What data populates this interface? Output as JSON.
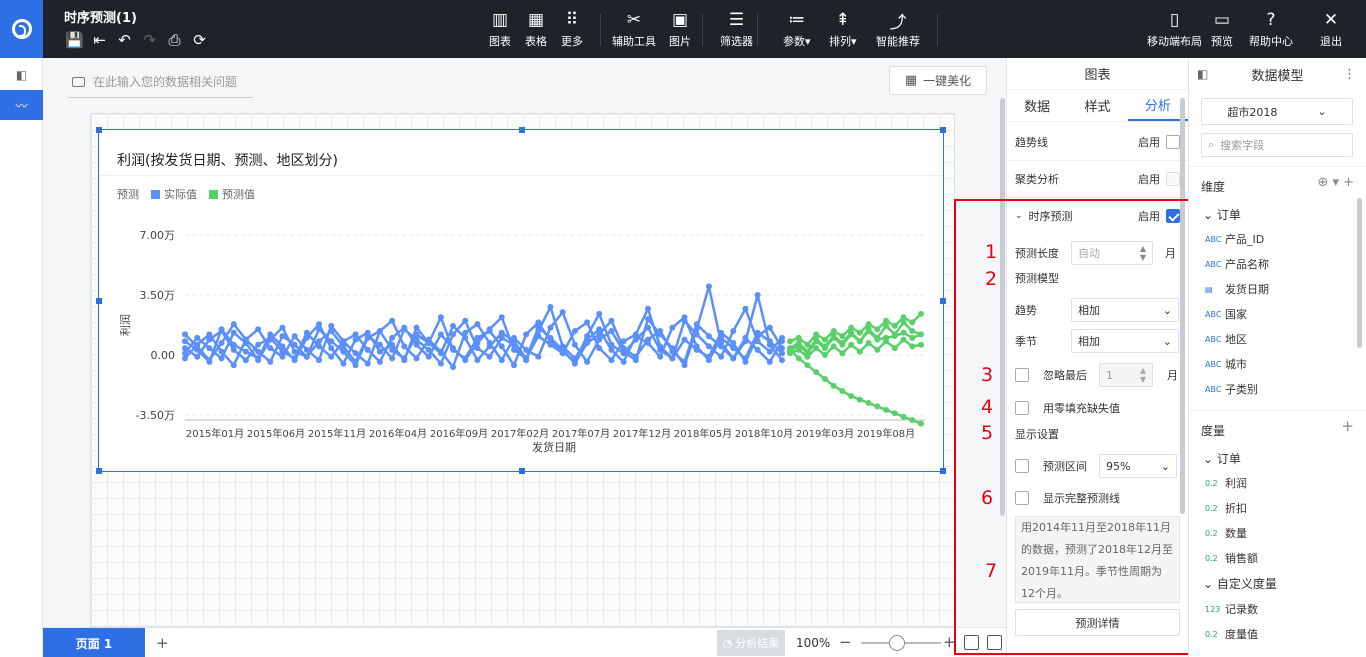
{
  "app": {
    "title": "时序预测(1)",
    "toolbar": [
      {
        "name": "chart",
        "label": "图表",
        "icon": "▥"
      },
      {
        "name": "table",
        "label": "表格",
        "icon": "▦"
      },
      {
        "name": "more",
        "label": "更多",
        "icon": "⠿"
      },
      {
        "name": "assist",
        "label": "辅助工具",
        "icon": "✂"
      },
      {
        "name": "image",
        "label": "图片",
        "icon": "▣"
      },
      {
        "name": "filter",
        "label": "筛选器",
        "icon": "☰"
      },
      {
        "name": "param",
        "label": "参数▾",
        "icon": "≔"
      },
      {
        "name": "layout",
        "label": "排列▾",
        "icon": "⇞"
      },
      {
        "name": "recommend",
        "label": "智能推荐",
        "icon": "⤴"
      }
    ],
    "right_actions": [
      {
        "name": "mobile",
        "label": "移动端布局",
        "icon": "▯"
      },
      {
        "name": "preview",
        "label": "预览",
        "icon": "▭"
      },
      {
        "name": "help",
        "label": "帮助中心",
        "icon": "?"
      },
      {
        "name": "exit",
        "label": "退出",
        "icon": "✕"
      }
    ]
  },
  "canvas": {
    "question_placeholder": "在此输入您的数据相关问题",
    "beautify_label": "一键美化"
  },
  "chart": {
    "title": "利润(按发货日期、预测、地区划分)",
    "legend_title": "预测",
    "legend_actual": "实际值",
    "legend_forecast": "预测值",
    "color_actual": "#5b8ff9",
    "color_forecast": "#5ad06b",
    "ylabel": "利润",
    "xlabel": "发货日期"
  },
  "chart_data": {
    "type": "line",
    "title": "利润(按发货日期、预测、地区划分)",
    "xlabel": "发货日期",
    "ylabel": "利润",
    "ylim": [
      -35000,
      70000
    ],
    "yticks": [
      "7.00万",
      "3.50万",
      "0.00",
      "-3.50万"
    ],
    "ytick_values": [
      70000,
      35000,
      0,
      -35000
    ],
    "xticks": [
      "2015年01月",
      "2015年06月",
      "2015年11月",
      "2016年04月",
      "2016年09月",
      "2017年02月",
      "2017年07月",
      "2017年12月",
      "2018年05月",
      "2018年10月",
      "2019年03月",
      "2019年08月"
    ],
    "legend": [
      "实际值",
      "预测值"
    ],
    "actual_series": [
      {
        "name": "实际值",
        "values": [
          8000,
          3000,
          -4000,
          15000,
          6000,
          2000,
          -2000,
          12000,
          5000,
          -3000,
          10000,
          18000,
          4000,
          -5000,
          9000,
          13000,
          2000,
          6000,
          -3000,
          16000,
          7000,
          22000,
          3000,
          -2000,
          10000,
          14000,
          5000,
          -6000,
          12000,
          19000,
          8000,
          2000,
          -4000,
          11000,
          24000,
          6000,
          1000,
          9000,
          16000,
          3000,
          -2000,
          20000,
          12000,
          5000,
          -1000,
          14000,
          27000,
          8000,
          2000,
          10000
        ]
      },
      {
        "name": "实际值",
        "values": [
          -2000,
          6000,
          12000,
          2000,
          -6000,
          9000,
          15000,
          4000,
          -1000,
          11000,
          3000,
          -3000,
          17000,
          8000,
          1000,
          -5000,
          14000,
          20000,
          5000,
          -2000,
          9000,
          2000,
          -7000,
          13000,
          18000,
          7000,
          -3000,
          10000,
          3000,
          -1000,
          16000,
          25000,
          6000,
          -4000,
          9000,
          14000,
          2000,
          -3000,
          21000,
          12000,
          4000,
          -6000,
          15000,
          40000,
          7000,
          -2000,
          10000,
          3000,
          -4000,
          8000
        ]
      },
      {
        "name": "实际值",
        "values": [
          4000,
          -1000,
          9000,
          14000,
          3000,
          -3000,
          6000,
          10000,
          2000,
          -2000,
          13000,
          5000,
          -1000,
          8000,
          12000,
          3000,
          -4000,
          10000,
          16000,
          6000,
          -1000,
          12000,
          4000,
          -3000,
          7000,
          15000,
          22000,
          3000,
          -2000,
          11000,
          6000,
          1000,
          14000,
          19000,
          4000,
          -3000,
          8000,
          12000,
          27000,
          5000,
          -2000,
          9000,
          3000,
          -1000,
          13000,
          7000,
          -4000,
          11000,
          16000,
          4000
        ]
      },
      {
        "name": "实际值",
        "values": [
          12000,
          5000,
          -3000,
          7000,
          18000,
          9000,
          2000,
          -4000,
          11000,
          6000,
          -1000,
          15000,
          8000,
          2000,
          -6000,
          10000,
          14000,
          3000,
          -2000,
          12000,
          7000,
          1000,
          17000,
          10000,
          -3000,
          5000,
          13000,
          8000,
          -2000,
          16000,
          10000,
          3000,
          -5000,
          7000,
          12000,
          20000,
          4000,
          -1000,
          9000,
          14000,
          2000,
          -4000,
          18000,
          11000,
          5000,
          -2000,
          8000,
          35000,
          6000,
          -3000
        ]
      },
      {
        "name": "实际值",
        "values": [
          1000,
          10000,
          4000,
          -2000,
          13000,
          7000,
          -3000,
          9000,
          16000,
          2000,
          -1000,
          8000,
          14000,
          5000,
          -4000,
          11000,
          6000,
          -2000,
          15000,
          9000,
          3000,
          -5000,
          12000,
          20000,
          4000,
          -1000,
          10000,
          6000,
          -3000,
          14000,
          28000,
          5000,
          -2000,
          9000,
          15000,
          3000,
          -4000,
          11000,
          7000,
          -1000,
          16000,
          22000,
          5000,
          -3000,
          10000,
          4000,
          -2000,
          13000,
          8000,
          1000
        ]
      }
    ],
    "forecast_series": [
      {
        "name": "预测值",
        "values": [
          8000,
          10000,
          6000,
          12000,
          9000,
          14000,
          11000,
          16000,
          13000,
          18000,
          15000,
          20000,
          17000,
          22000,
          19000,
          24000
        ]
      },
      {
        "name": "预测值",
        "values": [
          4000,
          7000,
          2000,
          9000,
          5000,
          11000,
          7000,
          13000,
          8000,
          15000,
          10000,
          17000,
          12000,
          19000,
          14000,
          12000
        ]
      },
      {
        "name": "预测值",
        "values": [
          2000,
          6000,
          1000,
          8000,
          4000,
          10000,
          6000,
          12000,
          8000,
          14000,
          9000,
          10000,
          11000,
          13000,
          10000,
          12000
        ]
      },
      {
        "name": "预测值",
        "values": [
          1000,
          3000,
          -1000,
          4000,
          0,
          5000,
          1000,
          6000,
          2000,
          7000,
          3000,
          8000,
          4000,
          9000,
          5000,
          6000
        ]
      },
      {
        "name": "预测值",
        "values": [
          3000,
          -2000,
          -6000,
          -10000,
          -14000,
          -18000,
          -21000,
          -24000,
          -26000,
          -28000,
          -30000,
          -32000,
          -34000,
          -36000,
          -38000,
          -40000
        ]
      }
    ]
  },
  "panel": {
    "title": "图表",
    "tabs": [
      "数据",
      "样式",
      "分析"
    ],
    "trend_label": "趋势线",
    "cluster_label": "聚类分析",
    "enable_label": "启用",
    "ts_label": "时序预测",
    "predict_len_label": "预测长度",
    "predict_len_placeholder": "自动",
    "month_unit": "月",
    "model_label": "预测模型",
    "trend_model_label": "趋势",
    "trend_model_value": "相加",
    "season_label": "季节",
    "season_value": "相加",
    "ignore_label": "忽略最后",
    "ignore_value": "1",
    "zero_fill_label": "用零填充缺失值",
    "display_label": "显示设置",
    "interval_label": "预测区间",
    "interval_value": "95%",
    "full_line_label": "显示完整预测线",
    "description": "用2014年11月至2018年11月的数据，预测了2018年12月至2019年11月。季节性周期为12个月。",
    "detail_button": "预测详情",
    "annotations": [
      "1",
      "2",
      "3",
      "4",
      "5",
      "6",
      "7"
    ]
  },
  "data_model": {
    "title": "数据模型",
    "dataset": "超市2018",
    "search_placeholder": "搜索字段",
    "dimensions_label": "维度",
    "dim_group": "订单",
    "dimensions": [
      {
        "type": "ABC",
        "name": "产品_ID"
      },
      {
        "type": "ABC",
        "name": "产品名称"
      },
      {
        "type": "date",
        "name": "发货日期"
      },
      {
        "type": "ABC",
        "name": "国家"
      },
      {
        "type": "ABC",
        "name": "地区"
      },
      {
        "type": "ABC",
        "name": "城市"
      },
      {
        "type": "ABC",
        "name": "子类别"
      }
    ],
    "measures_label": "度量",
    "measure_group": "订单",
    "measures": [
      {
        "type": "0.2",
        "name": "利润"
      },
      {
        "type": "0.2",
        "name": "折扣"
      },
      {
        "type": "0.2",
        "name": "数量"
      },
      {
        "type": "0.2",
        "name": "销售额"
      }
    ],
    "custom_group": "自定义度量",
    "custom_measures": [
      {
        "type": "123",
        "name": "记录数"
      },
      {
        "type": "0.2",
        "name": "度量值"
      }
    ]
  },
  "bottom": {
    "page_tab": "页面 1",
    "add_page": "+",
    "analysis_result": "分析结果",
    "zoom": "100%"
  }
}
